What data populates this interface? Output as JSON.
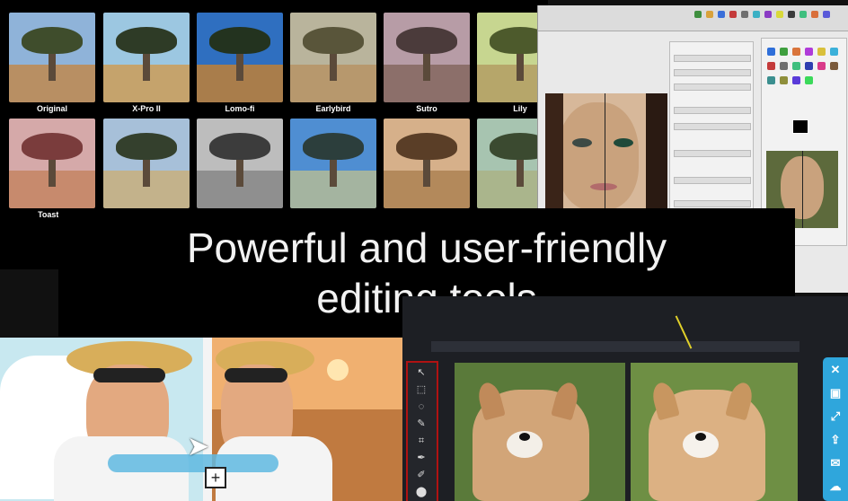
{
  "banner": {
    "title": "Powerful and user-friendly\nediting tools"
  },
  "filters": {
    "row1": [
      {
        "label": "Original",
        "sky": "#8fb3d9",
        "ground": "#b88f63",
        "canopy": "#3f4d2c"
      },
      {
        "label": "X-Pro II",
        "sky": "#9cc7e1",
        "ground": "#c5a36c",
        "canopy": "#2e3b26"
      },
      {
        "label": "Lomo-fi",
        "sky": "#2f6fc0",
        "ground": "#a97d4b",
        "canopy": "#23331f"
      },
      {
        "label": "Earlybird",
        "sky": "#b9b49c",
        "ground": "#b7986d",
        "canopy": "#59553a"
      },
      {
        "label": "Sutro",
        "sky": "#b79ca6",
        "ground": "#8c6f6a",
        "canopy": "#4b3b3b"
      },
      {
        "label": "Lily",
        "sky": "#c7d690",
        "ground": "#b6a66a",
        "canopy": "#4d5a2c"
      }
    ],
    "row2": [
      {
        "label": "Toaster",
        "sky": "#d5a9a9",
        "ground": "#c78a6d",
        "canopy": "#7a3c3c"
      },
      {
        "label": "",
        "sky": "#a7c0d9",
        "ground": "#c3b28b",
        "canopy": "#34402d"
      },
      {
        "label": "",
        "sky": "#bdbdbd",
        "ground": "#8f8f8f",
        "canopy": "#3c3c3c"
      },
      {
        "label": "",
        "sky": "#4f8ed2",
        "ground": "#a4b4a0",
        "canopy": "#2c3e3c"
      },
      {
        "label": "",
        "sky": "#d6b08a",
        "ground": "#b3895b",
        "canopy": "#5a3e27"
      },
      {
        "label": "",
        "sky": "#a7c4b0",
        "ground": "#aab58c",
        "canopy": "#3b4a30"
      }
    ]
  },
  "gimp": {
    "toolbar_colors": [
      "#3f8f3f",
      "#d9a23b",
      "#3b6fd9",
      "#c43b3b",
      "#6f6f6f",
      "#3bb0c4",
      "#8a3bc4",
      "#d9d93b",
      "#3b3b3b",
      "#3fbf7f",
      "#d96f3b",
      "#5a5ad9"
    ],
    "tool_colors": [
      "#2f6fd9",
      "#3f9f3f",
      "#d9743b",
      "#b03bd9",
      "#d9c03b",
      "#3bb0d9",
      "#c43b3b",
      "#6f6f6f",
      "#3fbf7f",
      "#2f3fb0",
      "#d93b8a",
      "#7a5a3b",
      "#3b8f8f",
      "#8f8f3b",
      "#5a3bd9",
      "#3bd95a"
    ]
  },
  "editor": {
    "tools": [
      "↖",
      "⬚",
      "◌",
      "✎",
      "⌗",
      "✒",
      "✐",
      "⬤"
    ],
    "share_icons": [
      "✕",
      "▣",
      "⤢",
      "⇪",
      "✉",
      "☁"
    ]
  },
  "colors": {
    "banner_bg": "#000000",
    "share_bar": "#2fa6dc",
    "tool_strip_border": "#b01212"
  }
}
